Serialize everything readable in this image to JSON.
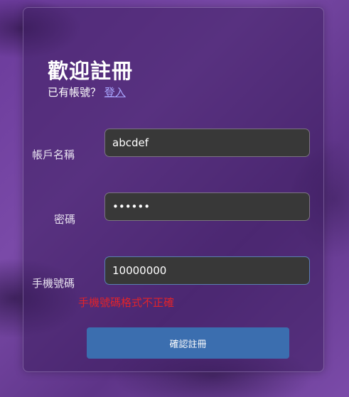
{
  "form": {
    "title": "歡迎註冊",
    "has_account_text": "已有帳號？",
    "login_link": "登入",
    "fields": {
      "username": {
        "label": "帳戶名稱",
        "value": "abcdef"
      },
      "password": {
        "label": "密碼",
        "value": "••••••"
      },
      "phone": {
        "label": "手機號碼",
        "value": "10000000"
      }
    },
    "error_message": "手機號碼格式不正確",
    "submit_label": "確認註冊"
  },
  "colors": {
    "background": "#6e3f9e",
    "input_bg": "#383838",
    "button_bg": "#3b6eaf",
    "error": "#e0232b",
    "link": "#a9a6ff"
  }
}
